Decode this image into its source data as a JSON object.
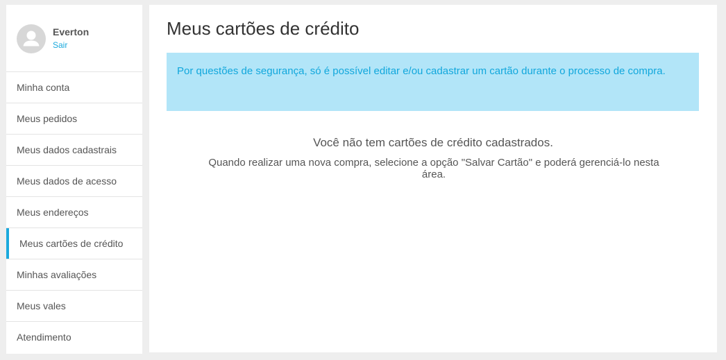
{
  "user": {
    "name": "Everton",
    "logout_label": "Sair"
  },
  "sidebar": {
    "items": [
      {
        "label": "Minha conta"
      },
      {
        "label": "Meus pedidos"
      },
      {
        "label": "Meus dados cadastrais"
      },
      {
        "label": "Meus dados de acesso"
      },
      {
        "label": "Meus endereços"
      },
      {
        "label": "Meus cartões de crédito",
        "active": true
      },
      {
        "label": "Minhas avaliações"
      },
      {
        "label": "Meus vales"
      },
      {
        "label": "Atendimento"
      }
    ]
  },
  "main": {
    "title": "Meus cartões de crédito",
    "notice": "Por questões de segurança, só é possível editar e/ou cadastrar um cartão durante o processo de compra.",
    "empty_title": "Você não tem cartões de crédito cadastrados.",
    "empty_message": "Quando realizar uma nova compra, selecione a opção \"Salvar Cartão\" e poderá gerenciá-lo nesta área."
  },
  "colors": {
    "accent": "#1aa9dd",
    "notice_bg": "#b2e5f8",
    "page_bg": "#eeeeee"
  },
  "icons": {
    "avatar": "user-silhouette-icon"
  }
}
